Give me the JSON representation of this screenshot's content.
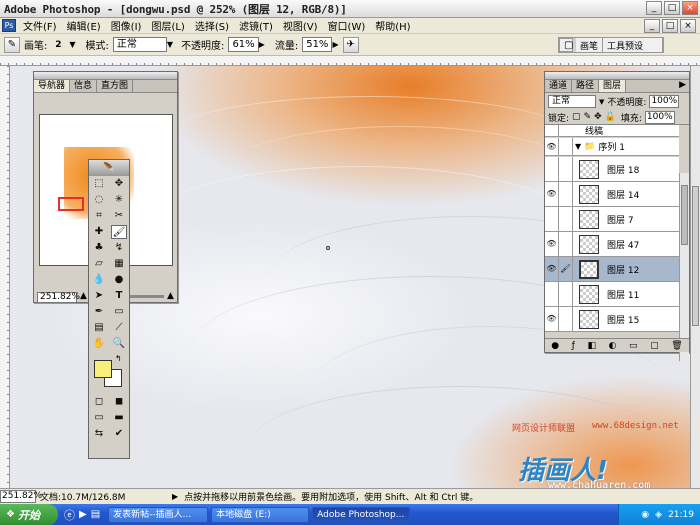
{
  "window": {
    "title": "Adobe Photoshop - [dongwu.psd @ 252% (图层 12, RGB/8)]",
    "min": "_",
    "max": "□",
    "close": "×"
  },
  "menu": {
    "items": [
      "文件(F)",
      "编辑(E)",
      "图像(I)",
      "图层(L)",
      "选择(S)",
      "滤镜(T)",
      "视图(V)",
      "窗口(W)",
      "帮助(H)"
    ],
    "doc_min": "_",
    "doc_max": "□",
    "doc_close": "×"
  },
  "options": {
    "brush_label": "画笔:",
    "brush_size": "2",
    "mode_label": "模式:",
    "mode_value": "正常",
    "opacity_label": "不透明度:",
    "opacity_value": "61%",
    "flow_label": "流量:",
    "flow_value": "51%",
    "well_tab1": "画笔",
    "well_tab2": "工具预设"
  },
  "navigator": {
    "tabs": [
      "导航器",
      "信息",
      "直方图"
    ],
    "zoom": "251.82%"
  },
  "layers": {
    "tabs": [
      "通道",
      "路径",
      "图层"
    ],
    "blend_mode": "正常",
    "opacity_label": "不透明度:",
    "opacity_value": "100%",
    "lock_label": "锁定:",
    "fill_label": "填充:",
    "fill_value": "100%",
    "top_layer": "线稿",
    "group": "序列 1",
    "rows": [
      {
        "name": "图层 18",
        "visible": false,
        "selected": false
      },
      {
        "name": "图层 14",
        "visible": true,
        "selected": false
      },
      {
        "name": "图层 7",
        "visible": false,
        "selected": false
      },
      {
        "name": "图层 47",
        "visible": true,
        "selected": false
      },
      {
        "name": "图层 12",
        "visible": true,
        "selected": true
      },
      {
        "name": "图层 11",
        "visible": false,
        "selected": false
      },
      {
        "name": "图层 15",
        "visible": true,
        "selected": false
      }
    ],
    "bottom_icons": [
      "link-icon",
      "effects-icon",
      "mask-icon",
      "adjustment-icon",
      "folder-icon",
      "new-layer-icon",
      "trash-icon"
    ]
  },
  "status": {
    "zoom": "251.82%",
    "doc": "文档:10.7M/126.8M",
    "hint": "点按并拖移以用前景色绘画。要用附加选项，使用 Shift、Alt 和 Ctrl 键。"
  },
  "taskbar": {
    "start": "开始",
    "tasks": [
      "发表新帖--插画人...",
      "本地磁盘 (E:)",
      "Adobe Photoshop..."
    ],
    "clock": "21:19"
  },
  "watermark": {
    "top_left": "网页设计师联盟",
    "top_right": "www.68design.net",
    "logo": "插画人!",
    "url": "www.chahuaren.com"
  },
  "colors": {
    "foreground": "#f8f07a",
    "background": "#ffffff"
  }
}
